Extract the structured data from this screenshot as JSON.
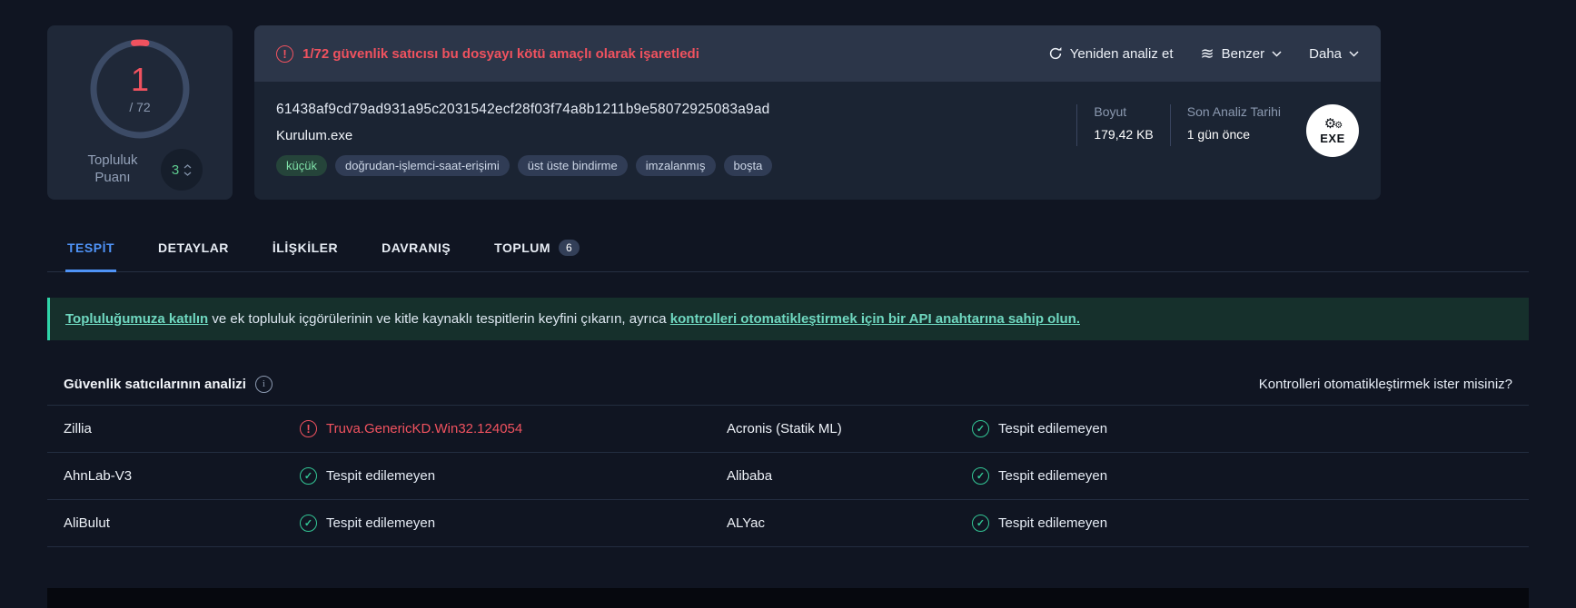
{
  "score_card": {
    "detections": "1",
    "total": "/ 72",
    "community_label": "Topluluk Puanı",
    "community_score": "3"
  },
  "header": {
    "warning": "1/72 güvenlik satıcısı bu dosyayı kötü amaçlı olarak işaretledi",
    "reanalyze_label": "Yeniden analiz et",
    "similar_label": "Benzer",
    "more_label": "Daha",
    "hash": "61438af9cd79ad931a95c2031542ecf28f03f74a8b1211b9e58072925083a9ad",
    "filename": "Kurulum.exe",
    "tags": [
      "küçük",
      "doğrudan-işlemci-saat-erişimi",
      "üst üste bindirme",
      "imzalanmış",
      "boşta"
    ],
    "size_label": "Boyut",
    "size_value": "179,42 KB",
    "date_label": "Son Analiz Tarihi",
    "date_value": "1 gün önce",
    "file_type": "EXE"
  },
  "tabs": {
    "tespit": "TESPİT",
    "detaylar": "DETAYLAR",
    "iliskiler": "İLİŞKİLER",
    "davranis": "DAVRANIŞ",
    "toplum": "TOPLUM",
    "toplum_badge": "6"
  },
  "banner": {
    "link_join": "Topluluğumuza katılın",
    "middle": " ve ek topluluk içgörülerinin ve kitle kaynaklı tespitlerin keyfini çıkarın, ayrıca ",
    "link_api": "kontrolleri otomatikleştirmek için bir API anahtarına sahip olun."
  },
  "analysis": {
    "title": "Güvenlik satıcılarının analizi",
    "cta": "Kontrolleri otomatikleştirmek ister misiniz?",
    "rows": [
      {
        "cells": [
          {
            "vendor": "Zillia",
            "result": "Truva.GenericKD.Win32.124054",
            "status": "malicious"
          },
          {
            "vendor": "Acronis (Statik ML)",
            "result": "Tespit edilemeyen",
            "status": "clean"
          }
        ]
      },
      {
        "cells": [
          {
            "vendor": "AhnLab-V3",
            "result": "Tespit edilemeyen",
            "status": "clean"
          },
          {
            "vendor": "Alibaba",
            "result": "Tespit edilemeyen",
            "status": "clean"
          }
        ]
      },
      {
        "cells": [
          {
            "vendor": "AliBulut",
            "result": "Tespit edilemeyen",
            "status": "clean"
          },
          {
            "vendor": "ALYac",
            "result": "Tespit edilemeyen",
            "status": "clean"
          }
        ]
      }
    ]
  },
  "colors": {
    "danger": "#f0525f",
    "success": "#33c796",
    "accent_blue": "#4f93f7",
    "banner_accent": "#2fd3a8"
  }
}
